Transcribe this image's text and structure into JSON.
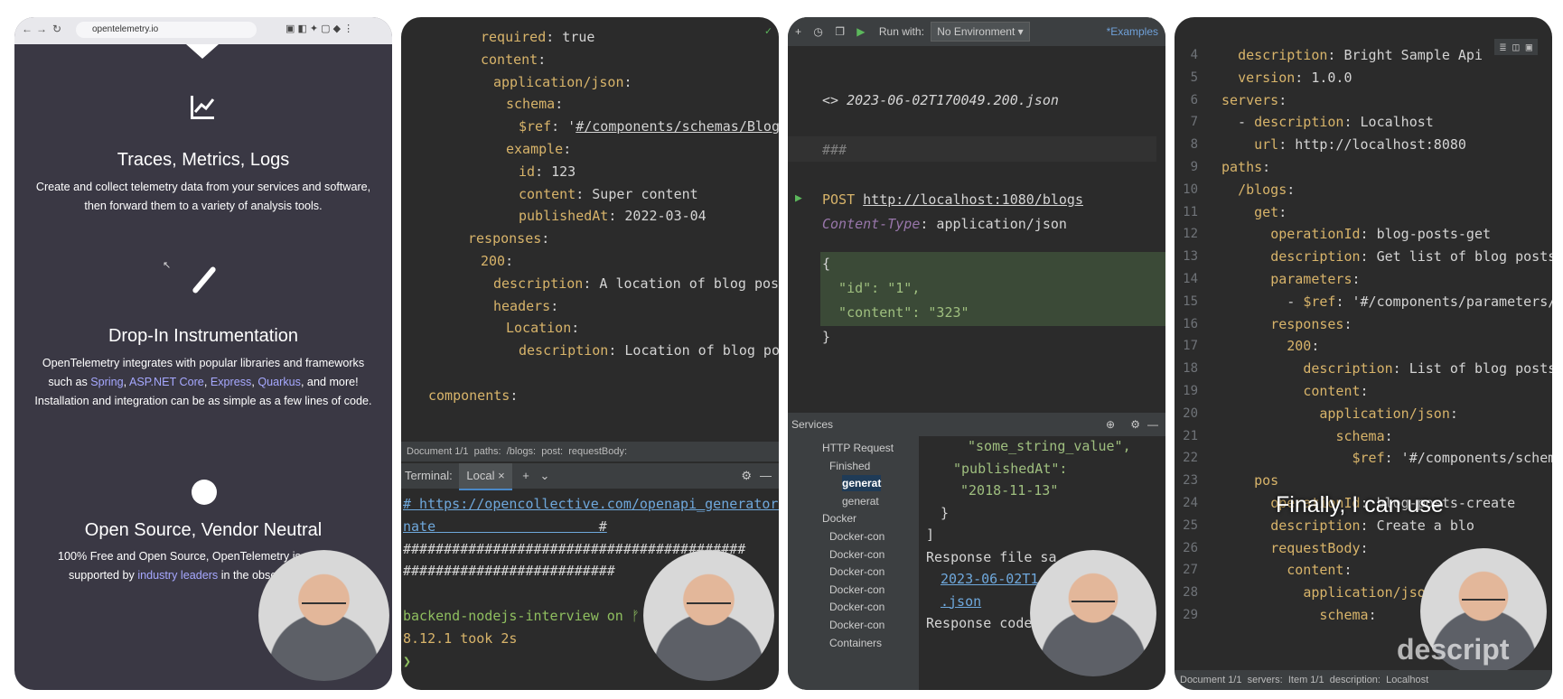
{
  "panel1": {
    "url": "opentelemetry.io",
    "features": [
      {
        "title": "Traces, Metrics, Logs",
        "text1": "Create and collect telemetry data from your services and software,",
        "text2": "then forward them to a variety of analysis tools."
      },
      {
        "title": "Drop-In Instrumentation",
        "text1": "OpenTelemetry integrates with popular libraries and frameworks",
        "such": "such as ",
        "l1": "Spring",
        "l2": "ASP.NET Core",
        "l3": "Express",
        "l4": "Quarkus",
        "tail": ", and more!",
        "text3": "Installation and integration can be as simple as a few lines of code."
      },
      {
        "title": "Open Source, Vendor Neutral",
        "text1": "100% Free and Open Source, OpenTelemetry is ad",
        "text2a": "supported by ",
        "link": "industry leaders",
        "text2b": " in the obse"
      }
    ]
  },
  "panel2": {
    "lines": [
      {
        "k": "required",
        "v": ": true"
      },
      {
        "k": "content",
        "v": ":"
      },
      {
        "k": "application/json",
        "v": ":"
      },
      {
        "k": "schema",
        "v": ":"
      },
      {
        "k": "$ref",
        "v": ": '",
        "u": "#/components/schemas/BlogPo"
      },
      {
        "k": "example",
        "v": ":"
      },
      {
        "k": "id",
        "v": ": 123"
      },
      {
        "k": "content",
        "v": ": Super content"
      },
      {
        "k": "publishedAt",
        "v": ": 2022-03-04"
      },
      {
        "k": "responses",
        "v": ":"
      },
      {
        "k": "200",
        "v": ":"
      },
      {
        "k": "description",
        "v": ": A location of blog post"
      },
      {
        "k": "headers",
        "v": ":"
      },
      {
        "k": "Location",
        "v": ":"
      },
      {
        "k": "description",
        "v": ": Location of blog post"
      },
      {
        "k": "",
        "v": ""
      },
      {
        "k": "components",
        "v": ":"
      }
    ],
    "breadcrumb": [
      "Document 1/1",
      "paths:",
      "/blogs:",
      "post:",
      "requestBody:"
    ],
    "terminal_label": "Terminal:",
    "terminal_tab": "Local",
    "term": [
      "# https://opencollective.com/openapi_generator/do",
      "nate",
      "##########################################",
      "##########################",
      "",
      "backend-nodejs-interview on ᚠ mai",
      "8.12.1 took 2s",
      "❯"
    ]
  },
  "panel3": {
    "run_with": "Run with:",
    "env": "No Environment",
    "examples": "*Examples",
    "file": "<> 2023-06-02T170049.200.json",
    "sep": "###",
    "method": "POST",
    "url": "http://localhost:1080/blogs",
    "header_k": "Content-Type",
    "header_v": ": application/json",
    "body": [
      "{",
      "  \"id\": \"1\",",
      "  \"content\": \"323\"",
      "}"
    ],
    "services": "Services",
    "tree": [
      "HTTP Request",
      "Finished",
      "generat",
      "generat",
      "Docker",
      "Docker-con",
      "Docker-con",
      "Docker-con",
      "Docker-con",
      "Docker-con",
      "Docker-con",
      "Containers"
    ],
    "resp": [
      "\"some_string_value\",",
      "\"publishedAt\":",
      "\"2018-11-13\"",
      "}",
      "]",
      "Response file sa",
      "2023-06-02T1",
      ".json",
      "Response code: 200 (OK);"
    ]
  },
  "panel4": {
    "lines": [
      {
        "n": "4",
        "t": "  description: Bright Sample Api"
      },
      {
        "n": "5",
        "t": "  version: 1.0.0"
      },
      {
        "n": "6",
        "t": "servers:"
      },
      {
        "n": "7",
        "t": "  - description: Localhost"
      },
      {
        "n": "8",
        "t": "    url: http://localhost:8080"
      },
      {
        "n": "9",
        "t": "paths:"
      },
      {
        "n": "10",
        "t": "  /blogs:"
      },
      {
        "n": "11",
        "t": "    get:"
      },
      {
        "n": "12",
        "t": "      operationId: blog-posts-get"
      },
      {
        "n": "13",
        "t": "      description: Get list of blog posts"
      },
      {
        "n": "14",
        "t": "      parameters:"
      },
      {
        "n": "15",
        "t": "        - $ref: '#/components/parameters/Page"
      },
      {
        "n": "16",
        "t": "      responses:"
      },
      {
        "n": "17",
        "t": "        200:"
      },
      {
        "n": "18",
        "t": "          description: List of blog posts"
      },
      {
        "n": "19",
        "t": "          content:"
      },
      {
        "n": "20",
        "t": "            application/json:"
      },
      {
        "n": "21",
        "t": "              schema:"
      },
      {
        "n": "22",
        "t": "                $ref: '#/components/schemas/B"
      },
      {
        "n": "23",
        "t": "    pos"
      },
      {
        "n": "24",
        "t": "      operationId: blog-posts-create"
      },
      {
        "n": "25",
        "t": "      description: Create a blo"
      },
      {
        "n": "26",
        "t": "      requestBody:"
      },
      {
        "n": "27",
        "t": "        content:"
      },
      {
        "n": "28",
        "t": "          application/json"
      },
      {
        "n": "29",
        "t": "            schema:"
      }
    ],
    "caption": "Finally, I can use",
    "watermark": "descript",
    "breadcrumb": [
      "Document 1/1",
      "servers:",
      "Item 1/1",
      "description:",
      "Localhost"
    ]
  }
}
